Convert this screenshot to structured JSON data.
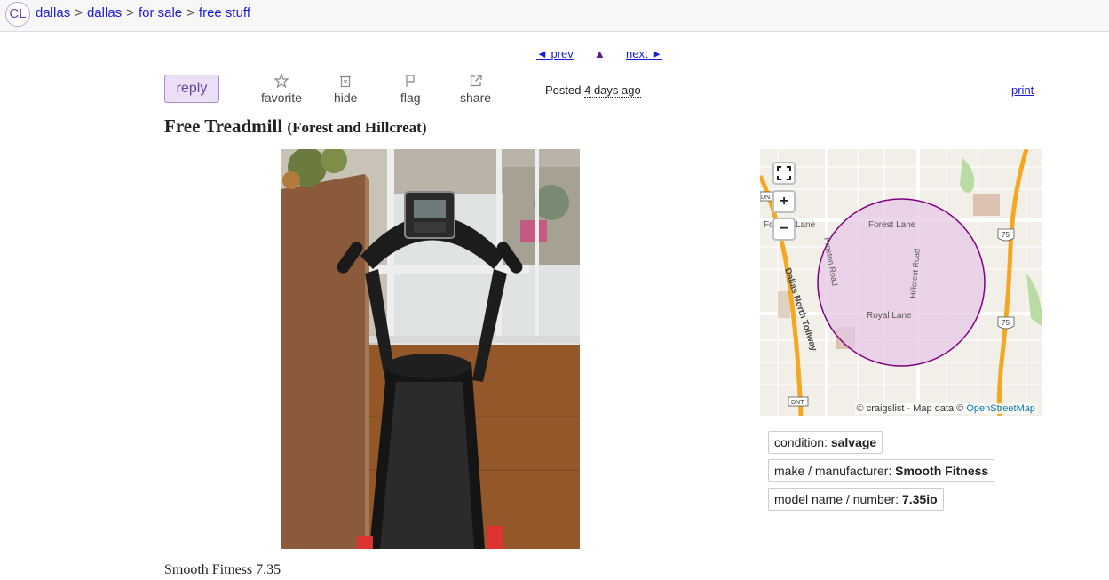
{
  "breadcrumb": {
    "logo": "CL",
    "items": [
      "dallas",
      "dallas",
      "for sale",
      "free stuff"
    ],
    "separator": ">"
  },
  "pager": {
    "prev": "◄ prev",
    "up": "▲",
    "next": "next ►"
  },
  "actions": {
    "reply": "reply",
    "favorite": "favorite",
    "hide": "hide",
    "flag": "flag",
    "share": "share"
  },
  "posted": {
    "label": "Posted",
    "ago": "4 days ago"
  },
  "print": "print",
  "post": {
    "title": "Free Treadmill",
    "location": "(Forest and Hillcreat)",
    "body": "Smooth Fitness 7.35"
  },
  "map": {
    "zoom_in": "+",
    "zoom_out": "−",
    "labels": {
      "forest_lane": "Forest Lane",
      "forest_lane_w": "Fo",
      "forest_lane_w2": "Lane",
      "royal_lane": "Royal Lane",
      "preston_road": "Preston Road",
      "hillcrest_road": "Hillcrest Road",
      "dnt": "Dallas North Tollway",
      "dnt_shield_top": "DNT",
      "dnt_shield_bottom": "DNT",
      "us75_top": "75",
      "us75_bottom": "75"
    },
    "attribution": "© craigslist - Map data ©",
    "attribution_link": "OpenStreetMap",
    "colors": {
      "circle_fill": "#e6c8e6",
      "circle_stroke": "#800080",
      "highway": "#f5a623",
      "park": "#b8dca4"
    }
  },
  "attributes": [
    {
      "key": "condition:",
      "value": "salvage"
    },
    {
      "key": "make / manufacturer:",
      "value": "Smooth Fitness"
    },
    {
      "key": "model name / number:",
      "value": "7.35io"
    }
  ],
  "theme": {
    "link": "#1c1ce0",
    "accent": "#6a3fa0",
    "reply_bg": "#eadff5"
  }
}
